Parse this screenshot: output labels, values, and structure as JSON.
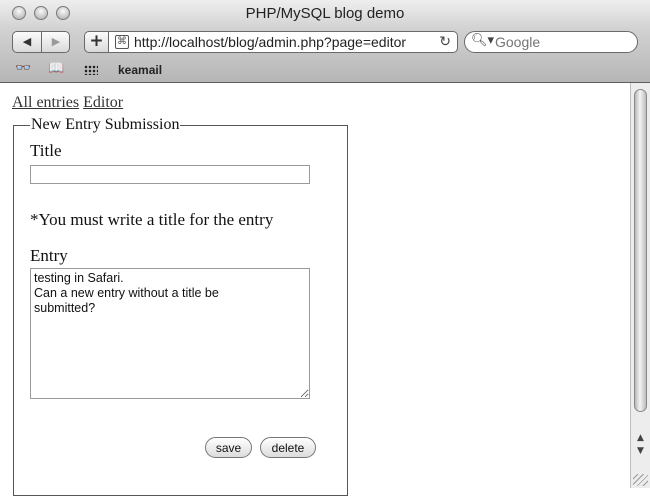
{
  "window": {
    "title": "PHP/MySQL blog demo"
  },
  "toolbar": {
    "url": "http://localhost/blog/admin.php?page=editor",
    "search_placeholder": "Google",
    "back_glyph": "◀",
    "forward_glyph": "▶",
    "add_glyph": "+",
    "reload_glyph": "↻"
  },
  "bookmarks": {
    "reading_glyph": "👓",
    "book_glyph": "📖",
    "items": [
      "keamail"
    ]
  },
  "page": {
    "nav_links": [
      "All entries",
      "Editor"
    ],
    "form": {
      "legend": "New Entry Submission",
      "title_label": "Title",
      "title_value": "",
      "error_message": "*You must write a title for the entry",
      "entry_label": "Entry",
      "entry_value": "testing in Safari.\nCan a new entry without a title be\nsubmitted?",
      "save_label": "save",
      "delete_label": "delete"
    }
  },
  "scrollbar": {
    "up_glyph": "▲",
    "down_glyph": "▼"
  },
  "colors": {
    "chrome_top": "#eeeeee",
    "chrome_bottom": "#b6b6b6",
    "text": "#111111"
  }
}
